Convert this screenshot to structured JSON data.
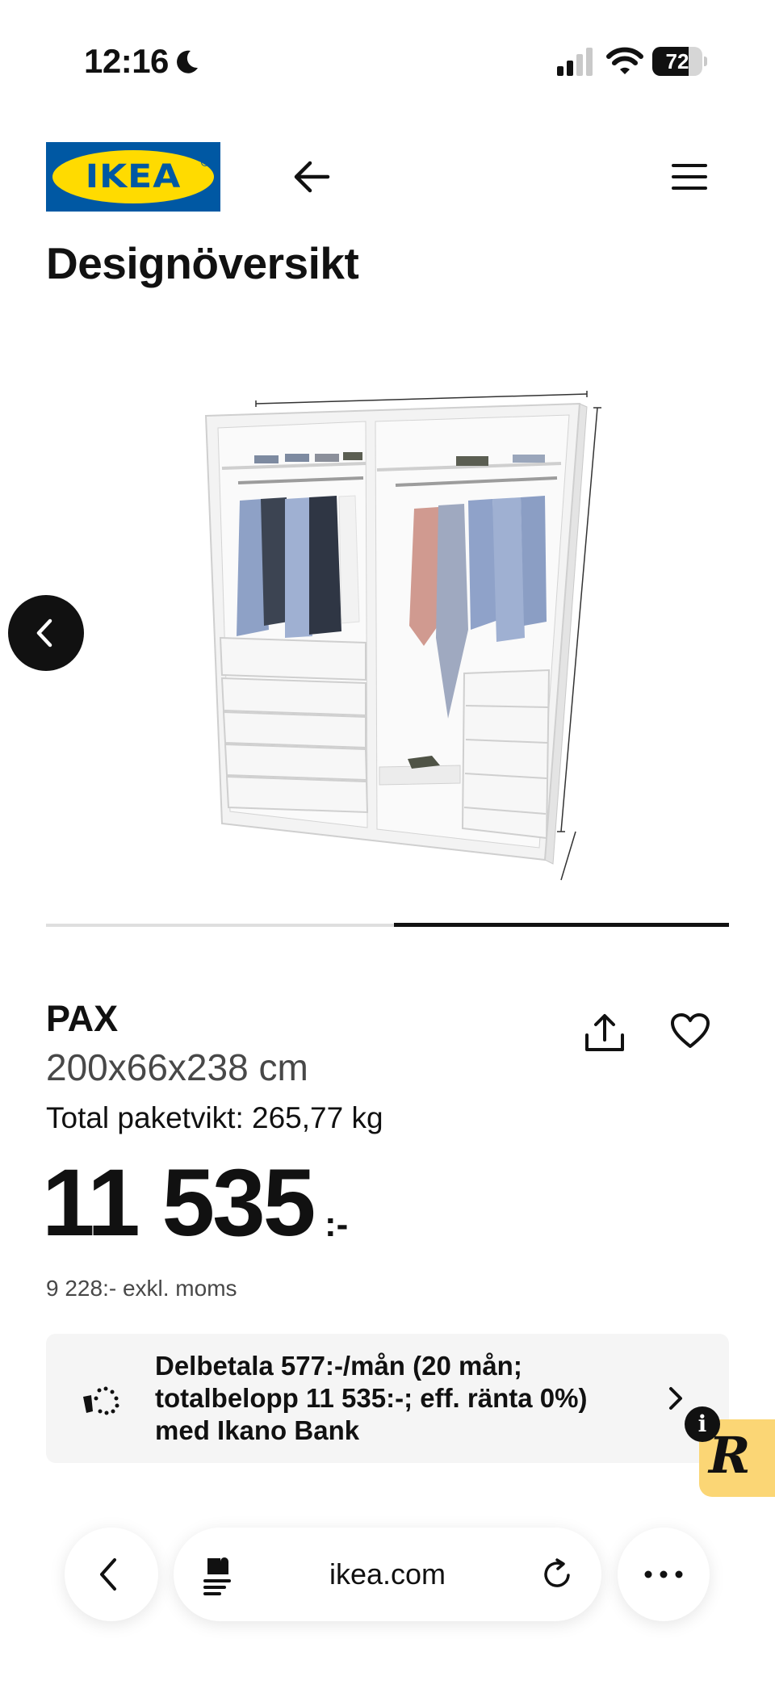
{
  "status_bar": {
    "time": "12:16",
    "battery_level": "72",
    "battery_fraction": 0.72,
    "signal_bars_active": 2,
    "signal_bars_total": 4,
    "icons": [
      "moon-icon",
      "signal-icon",
      "wifi-icon",
      "battery-icon"
    ]
  },
  "header": {
    "logo_text": "IKEA",
    "back_icon": "arrow-left-icon",
    "menu_icon": "hamburger-menu-icon"
  },
  "page": {
    "title": "Designöversikt"
  },
  "carousel": {
    "prev_icon": "chevron-left-icon",
    "position_fraction": 0.51,
    "visible_fraction": 0.49
  },
  "product": {
    "name": "PAX",
    "dimensions": "200x66x238 cm",
    "weight": "Total paketvikt: 265,77 kg",
    "price": "11 535",
    "price_suffix": ":-",
    "price_excl_vat": "9 228:-  exkl. moms",
    "actions": {
      "share_icon": "share-icon",
      "favorite_icon": "heart-icon"
    }
  },
  "financing": {
    "icon": "installment-icon",
    "text": "Delbetala 577:-/mån (20 mån; totalbelopp 11 535:-; eff. ränta 0%) med Ikano Bank",
    "chevron_icon": "chevron-right-icon"
  },
  "floating_widget": {
    "letter": "R",
    "badge": "i"
  },
  "browser": {
    "url": "ikea.com",
    "back_icon": "chevron-left-icon",
    "site_icon": "site-settings-icon",
    "reload_icon": "reload-icon",
    "more_icon": "more-dots-icon"
  },
  "colors": {
    "ikea_blue": "#0058a3",
    "ikea_yellow": "#ffdb00",
    "banner_background": "#f5f5f5",
    "widget_yellow": "#fbd675"
  }
}
